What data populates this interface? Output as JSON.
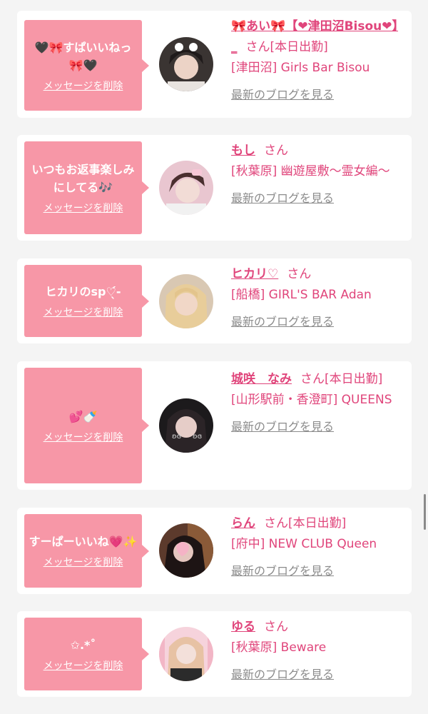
{
  "delete_label": "メッセージを削除",
  "san_label": "さん",
  "blog_label": "最新のブログを見る",
  "messages": [
    {
      "message": "🖤🎀すぱいいねっ🎀🖤",
      "name": "🎀あい🎀【❤津田沼Bisou❤】_",
      "status": "[本日出勤]",
      "shop": "[津田沼] Girls Bar Bisou",
      "avatar_icon": "profile-photo"
    },
    {
      "message": "いつもお返事楽しみにしてる🎶",
      "name": "もし",
      "status": "",
      "shop": "[秋葉原] 幽遊屋敷〜霊女編〜",
      "avatar_icon": "profile-photo"
    },
    {
      "message": "ヒカリのsp♡︎̖́-",
      "name": "ヒカリ♡",
      "status": "",
      "shop": "[船橋] GIRL'S BAR Adan",
      "avatar_icon": "profile-photo"
    },
    {
      "message": "💕🍼",
      "name": "城咲　なみ",
      "status": "[本日出勤]",
      "shop": "[山形駅前・香澄町] QUEENS",
      "avatar_icon": "profile-photo"
    },
    {
      "message": "すーぱーいいね💗✨",
      "name": "らん",
      "status": "[本日出勤]",
      "shop": "[府中] NEW CLUB Queen",
      "avatar_icon": "profile-photo"
    },
    {
      "message": "✩.*˚",
      "name": "ゆる",
      "status": "",
      "shop": "[秋葉原] Beware",
      "avatar_icon": "profile-photo"
    }
  ],
  "colors": {
    "bubble": "#f797a7",
    "accent": "#e0457b",
    "link_gray": "#8c8c8c",
    "background": "#f4f4f4"
  }
}
